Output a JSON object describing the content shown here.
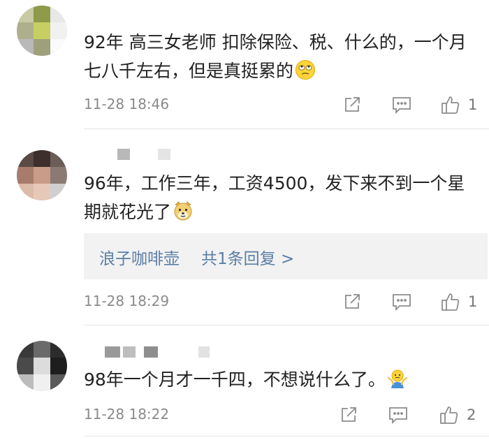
{
  "comments": [
    {
      "text": "92年 高三女老师 扣除保险、税、什么的，一个月七八千左右，但是真挺累的",
      "emoji": "eye-roll-emoji",
      "time": "11-28 18:46",
      "likes": "1"
    },
    {
      "text": "96年，工作三年，工资4500，发下来不到一个星期就花光了",
      "emoji": "doge-emoji",
      "reply_user": "浪子咖啡壶",
      "reply_count": "共1条回复 >",
      "time": "11-28 18:29",
      "likes": "1"
    },
    {
      "text": "98年一个月才一千四，不想说什么了。",
      "emoji": "shrug-emoji",
      "time": "11-28 18:22",
      "likes": "2"
    }
  ],
  "icons": {
    "share": "share-icon",
    "comment": "comment-icon",
    "like": "thumbs-up-icon"
  },
  "colors": {
    "link": "#5b7ea6",
    "meta_text": "#8a8a8a",
    "icon_stroke": "#8c8c8c",
    "reply_bg": "#f2f2f2"
  }
}
